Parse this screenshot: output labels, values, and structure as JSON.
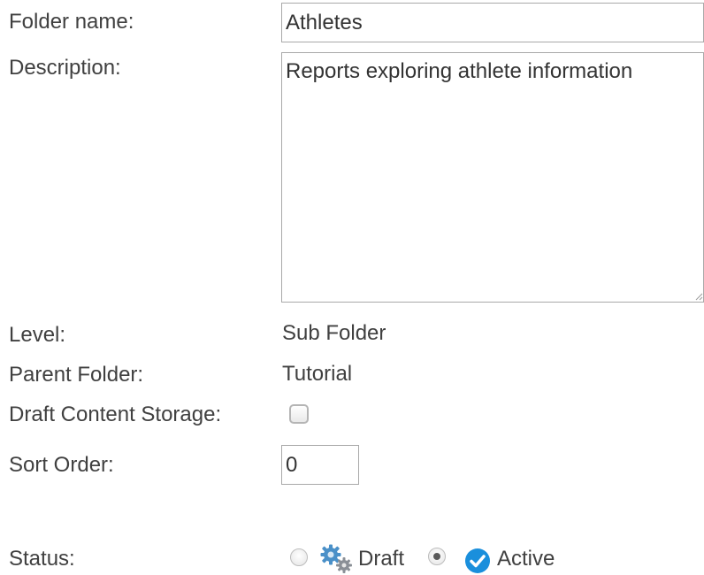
{
  "form": {
    "folder_name": {
      "label": "Folder name:",
      "value": "Athletes"
    },
    "description": {
      "label": "Description:",
      "value": "Reports exploring athlete information"
    },
    "level": {
      "label": "Level:",
      "value": "Sub Folder"
    },
    "parent_folder": {
      "label": "Parent Folder:",
      "value": "Tutorial"
    },
    "draft_content_storage": {
      "label": "Draft Content Storage:",
      "checked": false
    },
    "sort_order": {
      "label": "Sort Order:",
      "value": "0"
    },
    "status": {
      "label": "Status:",
      "options": [
        {
          "label": "Draft",
          "icon": "gears-icon",
          "selected": false
        },
        {
          "label": "Active",
          "icon": "check-circle-icon",
          "selected": true
        }
      ]
    }
  },
  "colors": {
    "text": "#404040",
    "input_border": "#a9a9a9",
    "active_icon": "#1a8fdc",
    "draft_icon": "#4a90c8"
  }
}
